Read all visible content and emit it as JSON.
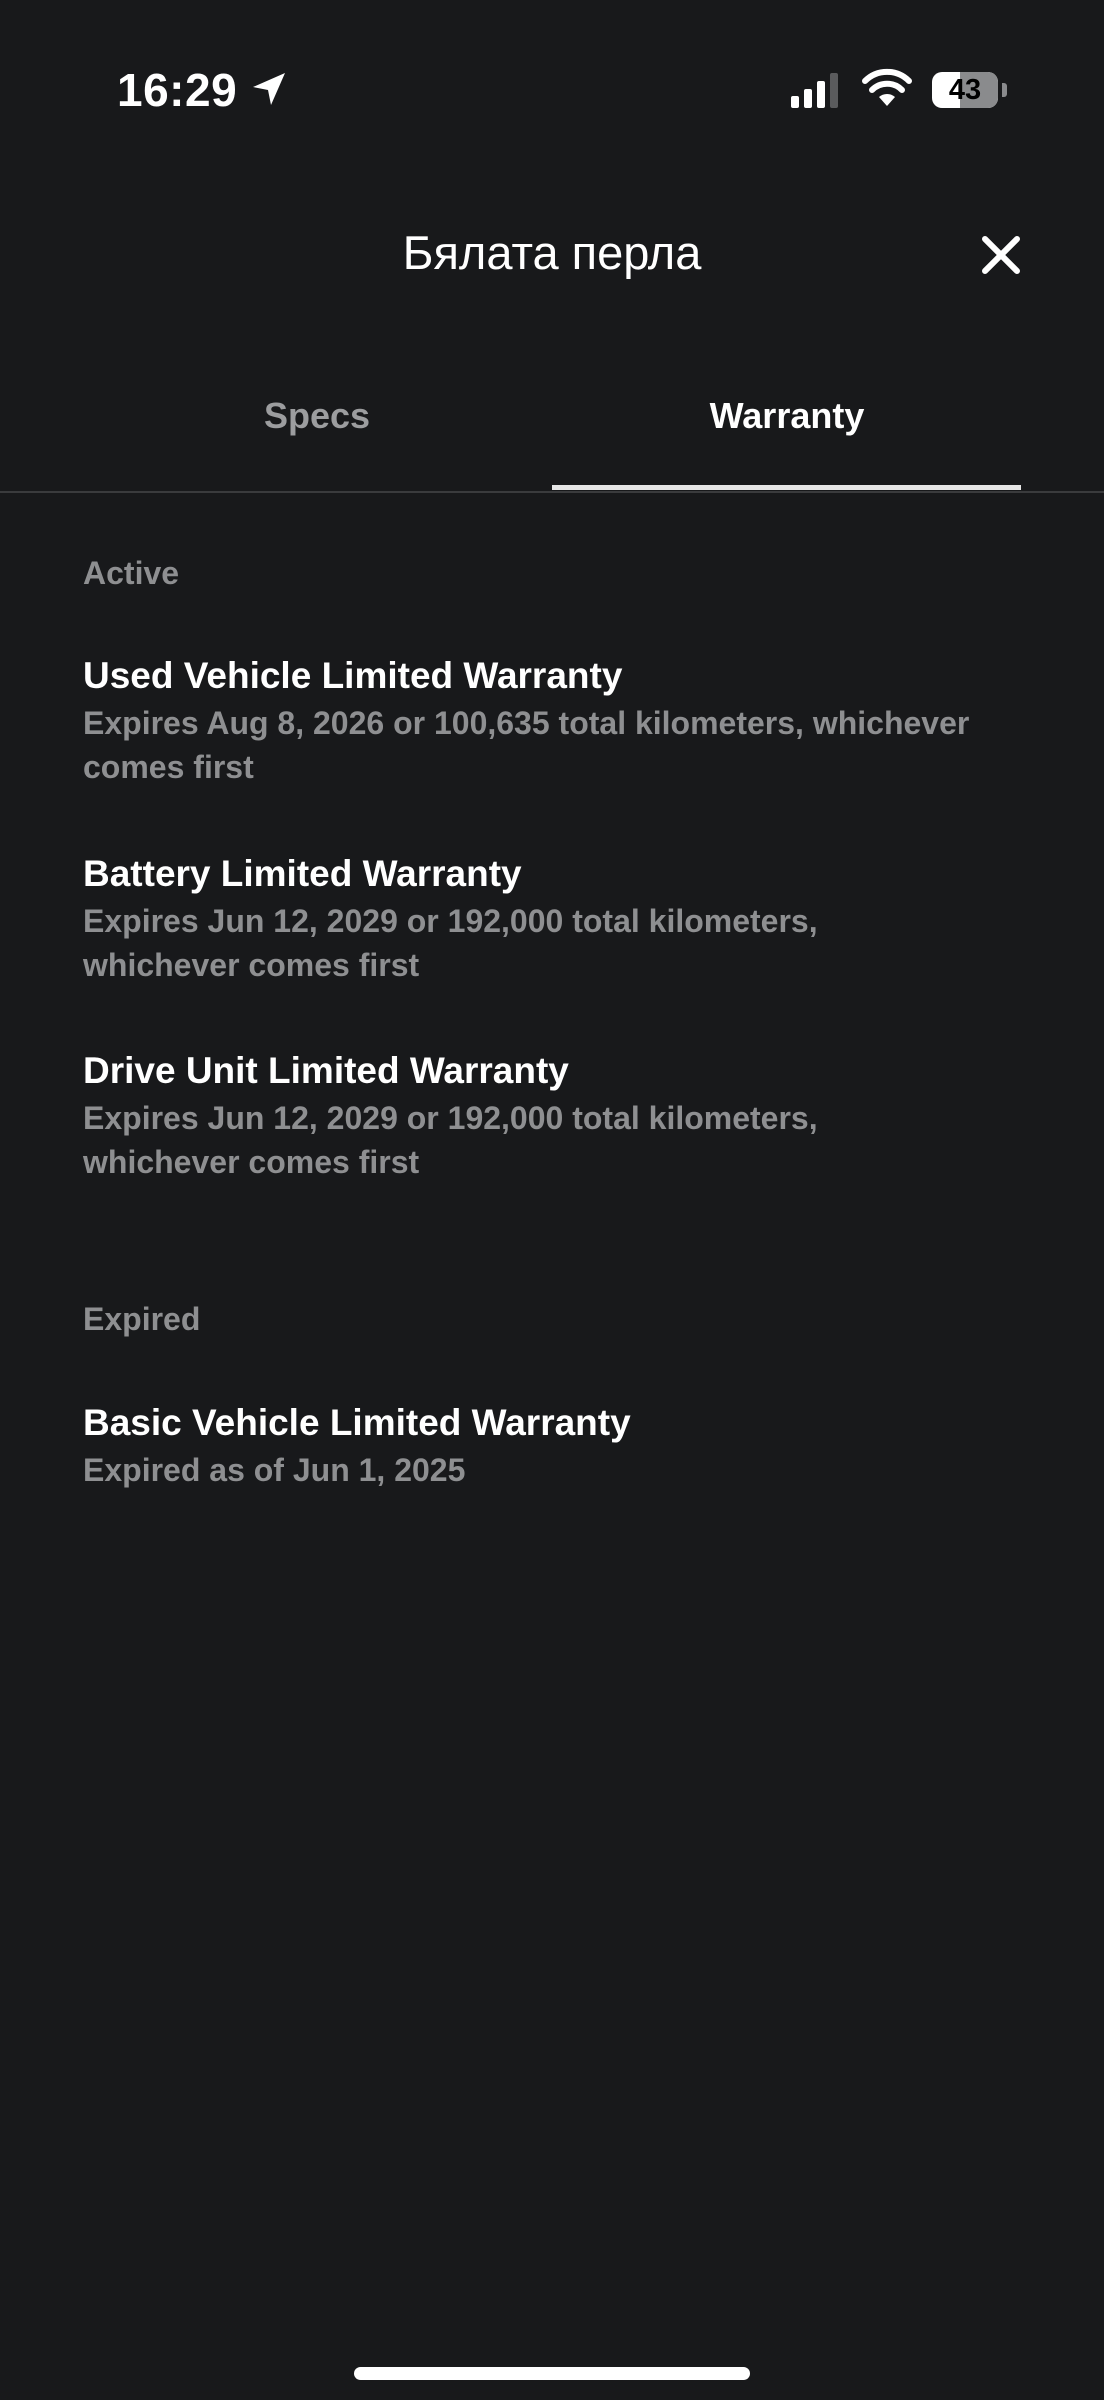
{
  "status_bar": {
    "time": "16:29",
    "battery_level": "43",
    "battery_fraction": 0.43,
    "icons": [
      "location-arrow-icon",
      "cellular-signal-icon",
      "wifi-icon",
      "battery-icon"
    ]
  },
  "header": {
    "title": "Бялата перла",
    "close_icon": "close-icon"
  },
  "tabs": [
    {
      "label": "Specs",
      "selected": false
    },
    {
      "label": "Warranty",
      "selected": true
    }
  ],
  "sections": {
    "active": {
      "heading": "Active",
      "items": [
        {
          "title": "Used Vehicle Limited Warranty",
          "description": "Expires Aug 8, 2026 or 100,635 total kilometers, whichever comes first"
        },
        {
          "title": "Battery Limited Warranty",
          "description": "Expires Jun 12, 2029 or 192,000 total kilometers, whichever comes first"
        },
        {
          "title": "Drive Unit Limited Warranty",
          "description": "Expires Jun 12, 2029 or 192,000 total kilometers, whichever comes first"
        }
      ]
    },
    "expired": {
      "heading": "Expired",
      "items": [
        {
          "title": "Basic Vehicle Limited Warranty",
          "description": "Expired as of Jun 1, 2025"
        }
      ]
    }
  },
  "colors": {
    "background": "#18191b",
    "primary_text": "#ffffff",
    "secondary_text": "#8e8f91",
    "divider": "#3a3b3d"
  }
}
